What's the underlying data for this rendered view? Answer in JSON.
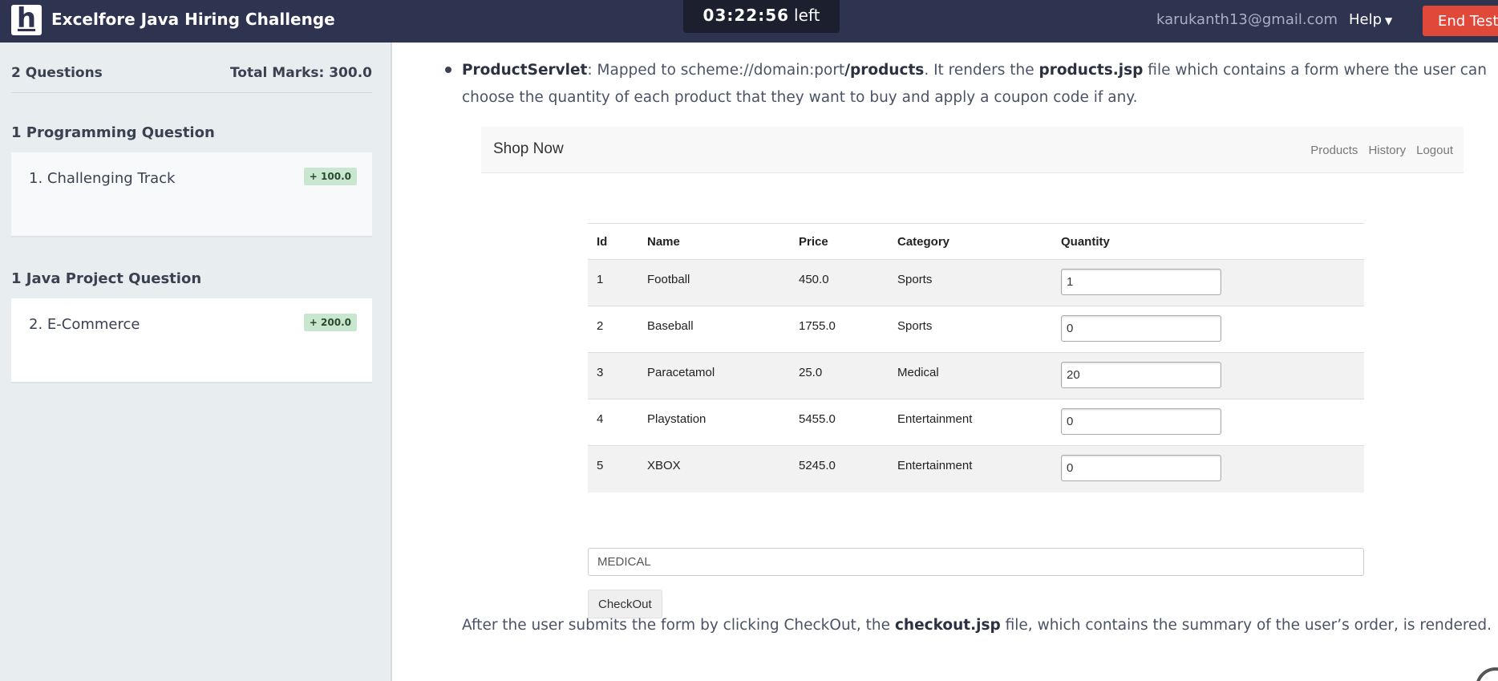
{
  "header": {
    "logo_letter": "h",
    "title": "Excelfore Java Hiring Challenge",
    "timer": {
      "time": "03:22:56",
      "suffix": "left"
    },
    "email": "karukanth13@gmail.com",
    "help_label": "Help",
    "end_test_label": "End Test"
  },
  "sidebar": {
    "question_count": "2 Questions",
    "total_marks": "Total Marks: 300.0",
    "sections": [
      {
        "title": "1 Programming Question",
        "question": {
          "name": "1. Challenging Track",
          "marks": "+ 100.0"
        }
      },
      {
        "title": "1 Java Project Question",
        "question": {
          "name": "2. E-Commerce",
          "marks": "+ 200.0"
        }
      }
    ]
  },
  "content": {
    "para1": {
      "servlet": "ProductServlet",
      "t1": ": Mapped to scheme://domain:port",
      "path": "/products",
      "t2": ". It renders the ",
      "jsp": "products.jsp",
      "t3": " file which contains a form where the user can choose the quantity of each product that they want to buy and apply a coupon code if any."
    },
    "para2": {
      "t1": "After the user submits the form by clicking  CheckOut, the ",
      "jsp": "checkout.jsp",
      "t2": " file, which contains the summary of the user’s order, is rendered."
    }
  },
  "shop": {
    "brand": "Shop Now",
    "nav_links": [
      "Products",
      "History",
      "Logout"
    ],
    "columns": [
      "Id",
      "Name",
      "Price",
      "Category",
      "Quantity"
    ],
    "rows": [
      {
        "id": "1",
        "name": "Football",
        "price": "450.0",
        "category": "Sports",
        "quantity": "1"
      },
      {
        "id": "2",
        "name": "Baseball",
        "price": "1755.0",
        "category": "Sports",
        "quantity": "0"
      },
      {
        "id": "3",
        "name": "Paracetamol",
        "price": "25.0",
        "category": "Medical",
        "quantity": "20"
      },
      {
        "id": "4",
        "name": "Playstation",
        "price": "5455.0",
        "category": "Entertainment",
        "quantity": "0"
      },
      {
        "id": "5",
        "name": "XBOX",
        "price": "5245.0",
        "category": "Entertainment",
        "quantity": "0"
      }
    ],
    "coupon_value": "MEDICAL",
    "checkout_label": "CheckOut"
  }
}
